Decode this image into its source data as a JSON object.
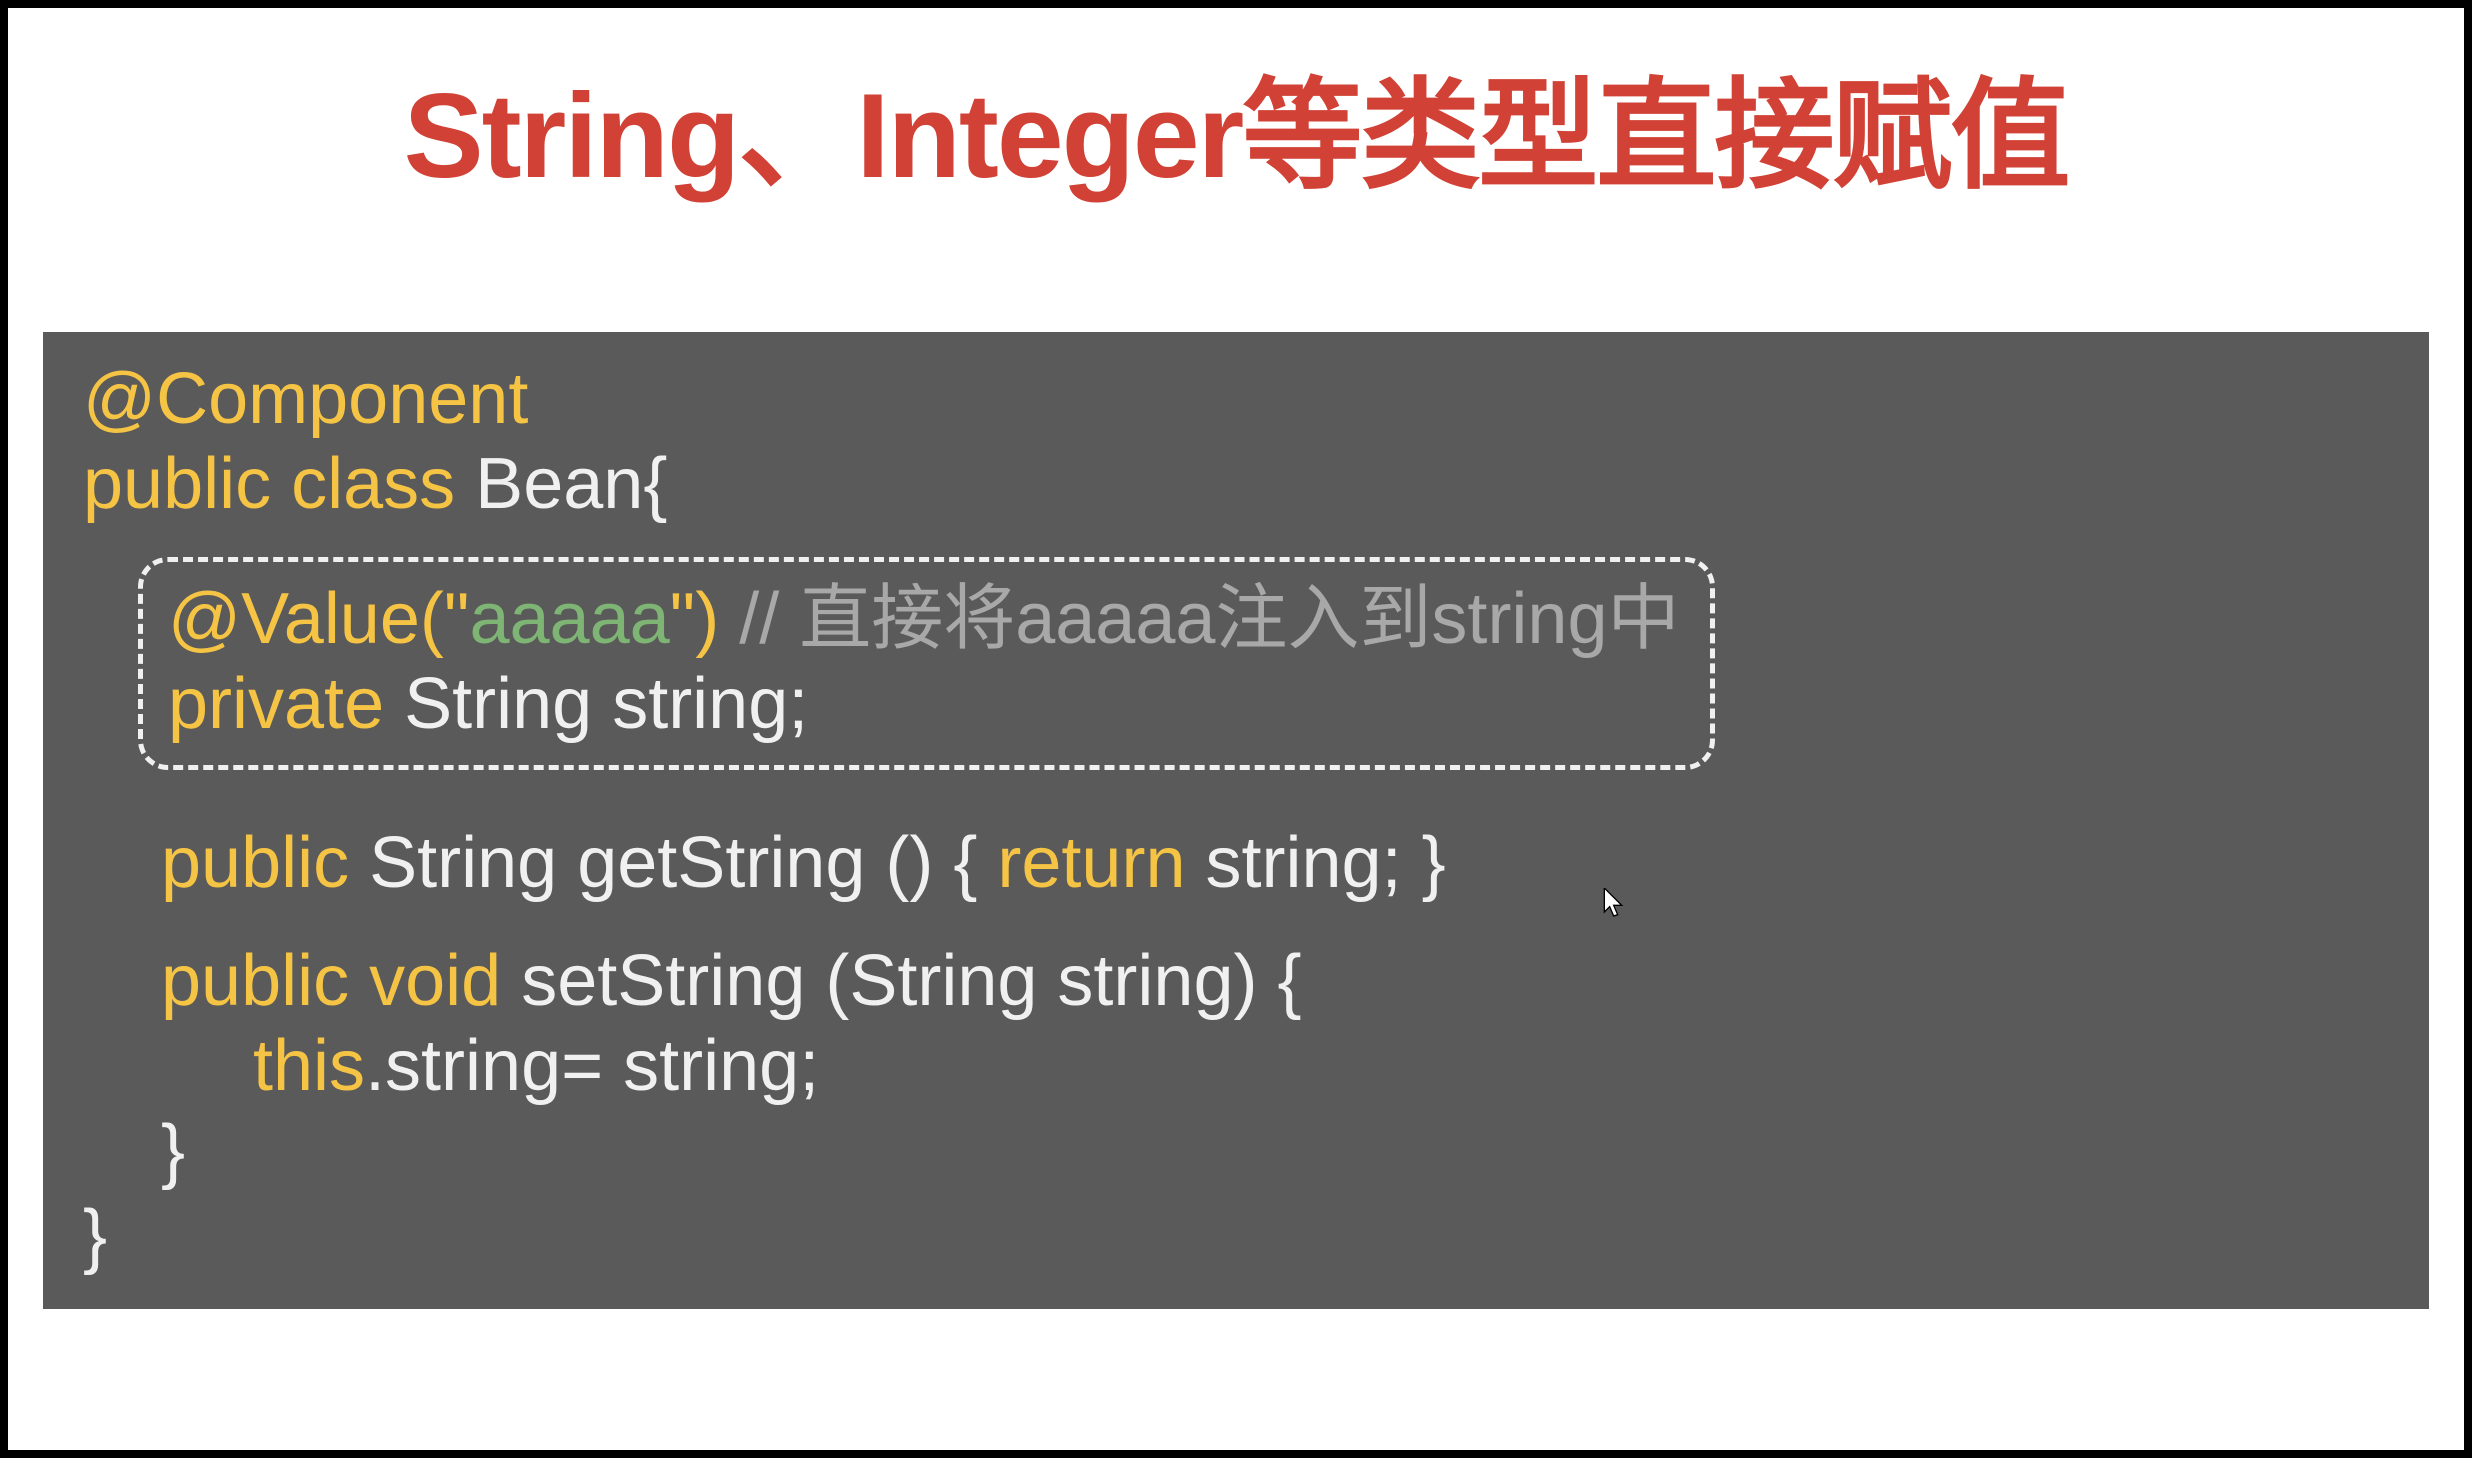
{
  "title": "String、Integer等类型直接赋值",
  "code": {
    "l1_component": "@Component",
    "l2_public_class": "public class ",
    "l2_bean": "Bean{",
    "l3_value": "@Value(",
    "l3_quote1": "\"",
    "l3_str": "aaaaa",
    "l3_quote2": "\"",
    "l3_close": ")",
    "l3_comment": " // 直接将aaaaa注入到string中",
    "l4_private": "private",
    "l4_rest": " String string;",
    "l5_public": "public",
    "l5_mid": " String getString () { ",
    "l5_return": "return",
    "l5_end": " string; }",
    "l6_public_void": "public void",
    "l6_rest": " setString (String string) {",
    "l7_this": "this",
    "l7_rest": ".string= string;",
    "l8_brace": "}",
    "l9_brace": "}"
  }
}
